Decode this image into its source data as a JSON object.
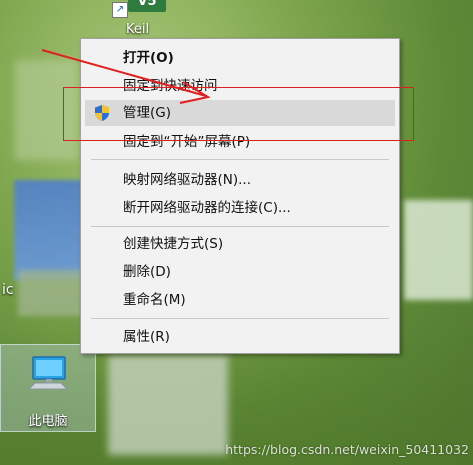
{
  "desktop": {
    "keil_badge": "V5",
    "keil_label": "Keil",
    "this_pc_label": "此电脑",
    "left_edge_text": "ic",
    "watermark": "https://blog.csdn.net/weixin_50411032"
  },
  "context_menu": {
    "items": [
      {
        "label": "打开(O)",
        "bold": true
      },
      {
        "label": "固定到快速访问"
      },
      {
        "label": "管理(G)",
        "icon": "uac-shield-icon",
        "highlighted": true
      },
      {
        "label": "固定到“开始”屏幕(P)"
      },
      {
        "label": "映射网络驱动器(N)..."
      },
      {
        "label": "断开网络驱动器的连接(C)..."
      },
      {
        "label": "创建快捷方式(S)"
      },
      {
        "label": "删除(D)"
      },
      {
        "label": "重命名(M)"
      },
      {
        "label": "属性(R)"
      }
    ]
  },
  "annotation": {
    "box_color": "#e02020",
    "arrow_color": "#e02020"
  }
}
